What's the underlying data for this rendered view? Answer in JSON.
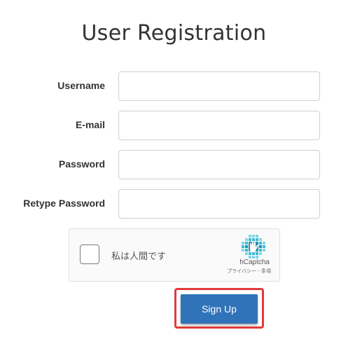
{
  "page": {
    "title": "User Registration"
  },
  "form": {
    "fields": [
      {
        "label": "Username",
        "value": "",
        "placeholder": ""
      },
      {
        "label": "E-mail",
        "value": "",
        "placeholder": ""
      },
      {
        "label": "Password",
        "value": "",
        "placeholder": ""
      },
      {
        "label": "Retype Password",
        "value": "",
        "placeholder": ""
      }
    ],
    "submit_label": "Sign Up"
  },
  "captcha": {
    "checkbox_label": "私は人間です",
    "brand": "hCaptcha",
    "links": "プライバシー - 条項",
    "checked": false,
    "icon": "hcaptcha-logo-icon"
  },
  "colors": {
    "button": "#3173b8",
    "highlight": "#e03b3b",
    "captcha_logo": "#4ec3d8"
  }
}
